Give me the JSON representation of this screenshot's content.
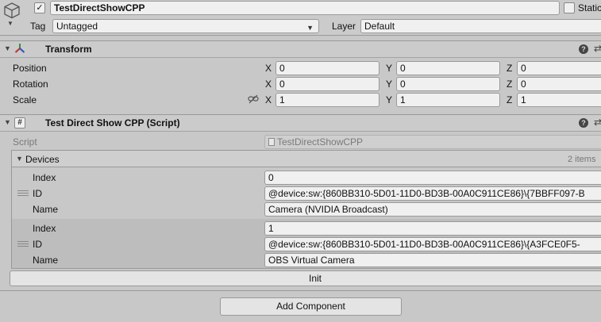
{
  "gameobject": {
    "active": true,
    "name": "TestDirectShowCPP",
    "static_label": "Static",
    "tag_label": "Tag",
    "tag_value": "Untagged",
    "layer_label": "Layer",
    "layer_value": "Default"
  },
  "transform": {
    "title": "Transform",
    "rows": [
      {
        "label": "Position",
        "x": "0",
        "y": "0",
        "z": "0"
      },
      {
        "label": "Rotation",
        "x": "0",
        "y": "0",
        "z": "0"
      },
      {
        "label": "Scale",
        "x": "1",
        "y": "1",
        "z": "1"
      }
    ],
    "axis": {
      "x": "X",
      "y": "Y",
      "z": "Z"
    }
  },
  "script_component": {
    "title": "Test Direct Show CPP (Script)",
    "script_label": "Script",
    "script_value": "TestDirectShowCPP",
    "devices_label": "Devices",
    "devices_count": "2 items",
    "devices": [
      {
        "index_label": "Index",
        "index": "0",
        "id_label": "ID",
        "id": "@device:sw:{860BB310-5D01-11D0-BD3B-00A0C911CE86}\\{7BBFF097-B",
        "name_label": "Name",
        "name": "Camera (NVIDIA Broadcast)"
      },
      {
        "index_label": "Index",
        "index": "1",
        "id_label": "ID",
        "id": "@device:sw:{860BB310-5D01-11D0-BD3B-00A0C911CE86}\\{A3FCE0F5-",
        "name_label": "Name",
        "name": "OBS Virtual Camera"
      }
    ],
    "init_button": "Init"
  },
  "add_component_button": "Add Component"
}
